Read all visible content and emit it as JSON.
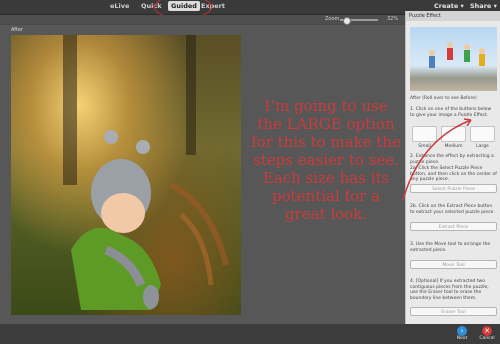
{
  "topbar": {
    "tabs": [
      {
        "label": "eLive",
        "active": false
      },
      {
        "label": "Quick",
        "active": false
      },
      {
        "label": "Guided",
        "active": true
      },
      {
        "label": "Expert",
        "active": false
      }
    ],
    "create_label": "Create",
    "share_label": "Share"
  },
  "zoom": {
    "label": "Zoom",
    "value": "32%"
  },
  "canvas": {
    "view_label": "After"
  },
  "overlay_text": "I’m going to use the LARGE option for this to make the steps easier to see. Each size has its potential for a great look.",
  "panel": {
    "title": "Puzzle Effect",
    "after_caption": "After (Roll over to see Before)",
    "step1": "1. Click on one of the buttons below to give your image a Puzzle Effect.",
    "sizes": [
      "Small",
      "Medium",
      "Large"
    ],
    "step2": "2. Enhance the effect by extracting a puzzle piece.",
    "step2a": "2a. Click the Select Puzzle Piece button, and then click on the center of any puzzle piece.",
    "select_btn": "Select Puzzle Piece",
    "step2b": "2b. Click on the Extract Piece button to extract your selected puzzle piece.",
    "extract_btn": "Extract Piece",
    "step3": "3. Use the Move tool to arrange the extracted piece.",
    "move_btn": "Move Tool",
    "step4": "4. [Optional] If you extracted two contiguous pieces from the puzzle, use the Eraser tool to erase the boundary line between them.",
    "eraser_btn": "Eraser Tool"
  },
  "bottom": {
    "next_label": "Next",
    "cancel_label": "Cancel"
  },
  "colors": {
    "annotation_red": "#cc3b3b",
    "next_blue": "#2f8fd6",
    "cancel_red": "#d23b3b"
  }
}
